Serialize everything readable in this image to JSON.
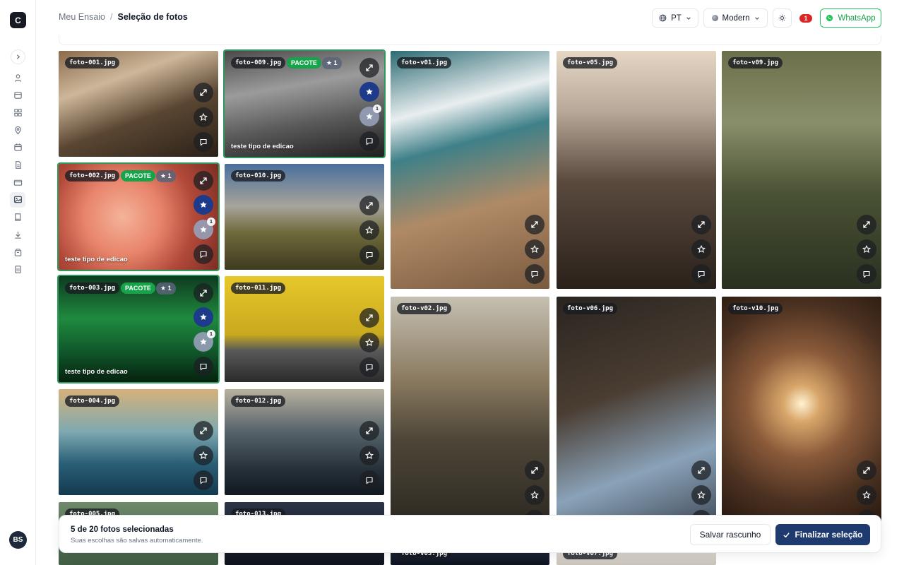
{
  "sidebar": {
    "logo": "C",
    "avatar": "BS",
    "items": [
      {
        "name": "user-icon"
      },
      {
        "name": "calendar-icon"
      },
      {
        "name": "grid-icon"
      },
      {
        "name": "map-pin-icon"
      },
      {
        "name": "calendar-alt-icon"
      },
      {
        "name": "file-icon"
      },
      {
        "name": "credit-card-icon"
      },
      {
        "name": "image-icon",
        "active": true
      },
      {
        "name": "book-icon"
      },
      {
        "name": "download-icon"
      },
      {
        "name": "package-icon"
      },
      {
        "name": "building-icon"
      }
    ]
  },
  "header": {
    "breadcrumb_parent": "Meu Ensaio",
    "breadcrumb_sep": "/",
    "breadcrumb_current": "Seleção de fotos",
    "language": "PT",
    "theme": "Modern",
    "notification_count": "1",
    "whatsapp": "WhatsApp"
  },
  "photos": [
    {
      "file": "foto-001.jpg",
      "bg": "linear-gradient(160deg,#8a6a4a 0%,#cdb79a 30%,#5a4632 60%,#2b2118 100%)"
    },
    {
      "file": "foto-002.jpg",
      "bg": "radial-gradient(circle at 40% 50%,#f4b39a 0%,#e8846b 35%,#b24a3a 65%,#7c2d24 100%)",
      "selected": true,
      "pacote": "PACOTE",
      "stars": "★ 1",
      "edit": "teste tipo de edicao",
      "mini": "1"
    },
    {
      "file": "foto-003.jpg",
      "bg": "linear-gradient(180deg,#0d3b1f 0%,#1f8a3f 40%,#0f5128 75%,#06220f 100%)",
      "selected": true,
      "pacote": "PACOTE",
      "stars": "★ 1",
      "edit": "teste tipo de edicao",
      "mini": "1"
    },
    {
      "file": "foto-004.jpg",
      "bg": "linear-gradient(180deg,#d6b27a 0%,#7ea9b0 40%,#2a5f78 70%,#133a4f 100%)"
    },
    {
      "file": "foto-005.jpg",
      "bg": "linear-gradient(180deg,#6f8a6a 0%,#3f5e44 100%)"
    },
    {
      "file": "foto-009.jpg",
      "bg": "linear-gradient(170deg,#4a4a4a 0%,#9b9b9b 35%,#5a5a5a 65%,#1f1f1f 100%)",
      "selected": true,
      "pacote": "PACOTE",
      "stars": "★ 1",
      "edit": "teste tipo de edicao",
      "mini": "1"
    },
    {
      "file": "foto-010.jpg",
      "bg": "linear-gradient(180deg,#4a6f9c 0%,#a7a49b 40%,#6f6a3b 65%,#3e3a1f 100%)"
    },
    {
      "file": "foto-011.jpg",
      "bg": "linear-gradient(180deg,#e7c82a 0%,#c9a91e 55%,#5a5a5a 70%,#2b2b2b 100%)"
    },
    {
      "file": "foto-012.jpg",
      "bg": "linear-gradient(180deg,#b9b2a0 0%,#56636a 40%,#27313a 75%,#11181f 100%)"
    },
    {
      "file": "foto-013.jpg",
      "bg": "linear-gradient(180deg,#2c3447 0%,#10141d 100%)"
    },
    {
      "file": "foto-v01.jpg",
      "bg": "linear-gradient(165deg,#2c6b73 0%,#e9eef0 25%,#3f8088 40%,#b08a66 65%,#7a5a3f 100%)"
    },
    {
      "file": "foto-v02.jpg",
      "bg": "linear-gradient(180deg,#c5c0b2 0%,#8a7a5f 35%,#4d4638 60%,#2a2620 100%)"
    },
    {
      "file": "foto-v03.jpg",
      "bg": "linear-gradient(180deg,#243047 0%,#0f1420 100%)"
    },
    {
      "file": "foto-v05.jpg",
      "bg": "linear-gradient(180deg,#e5d7c4 0%,#b9a99a 25%,#5a4a3e 55%,#2a211b 100%)"
    },
    {
      "file": "foto-v06.jpg",
      "bg": "linear-gradient(160deg,#2a2520 0%,#4a3d32 40%,#8aa2b8 70%,#3a4350 100%)"
    },
    {
      "file": "foto-v07.jpg",
      "bg": "linear-gradient(180deg,#e7e4df 0%,#c9c4bb 100%)"
    },
    {
      "file": "foto-v09.jpg",
      "bg": "linear-gradient(180deg,#6b6f4a 0%,#8a8f6b 30%,#4a5234 60%,#2a3020 100%)"
    },
    {
      "file": "foto-v10.jpg",
      "bg": "radial-gradient(circle at 50% 45%,#fff2d2 0%,#d8a66a 12%,#8a5a3a 35%,#4a3020 65%,#1f140c 100%)"
    }
  ],
  "bottom_bar": {
    "count_text": "5 de 20 fotos selecionadas",
    "note": "Suas escolhas são salvas automaticamente.",
    "draft_label": "Salvar rascunho",
    "finalize_label": "Finalizar seleção"
  }
}
